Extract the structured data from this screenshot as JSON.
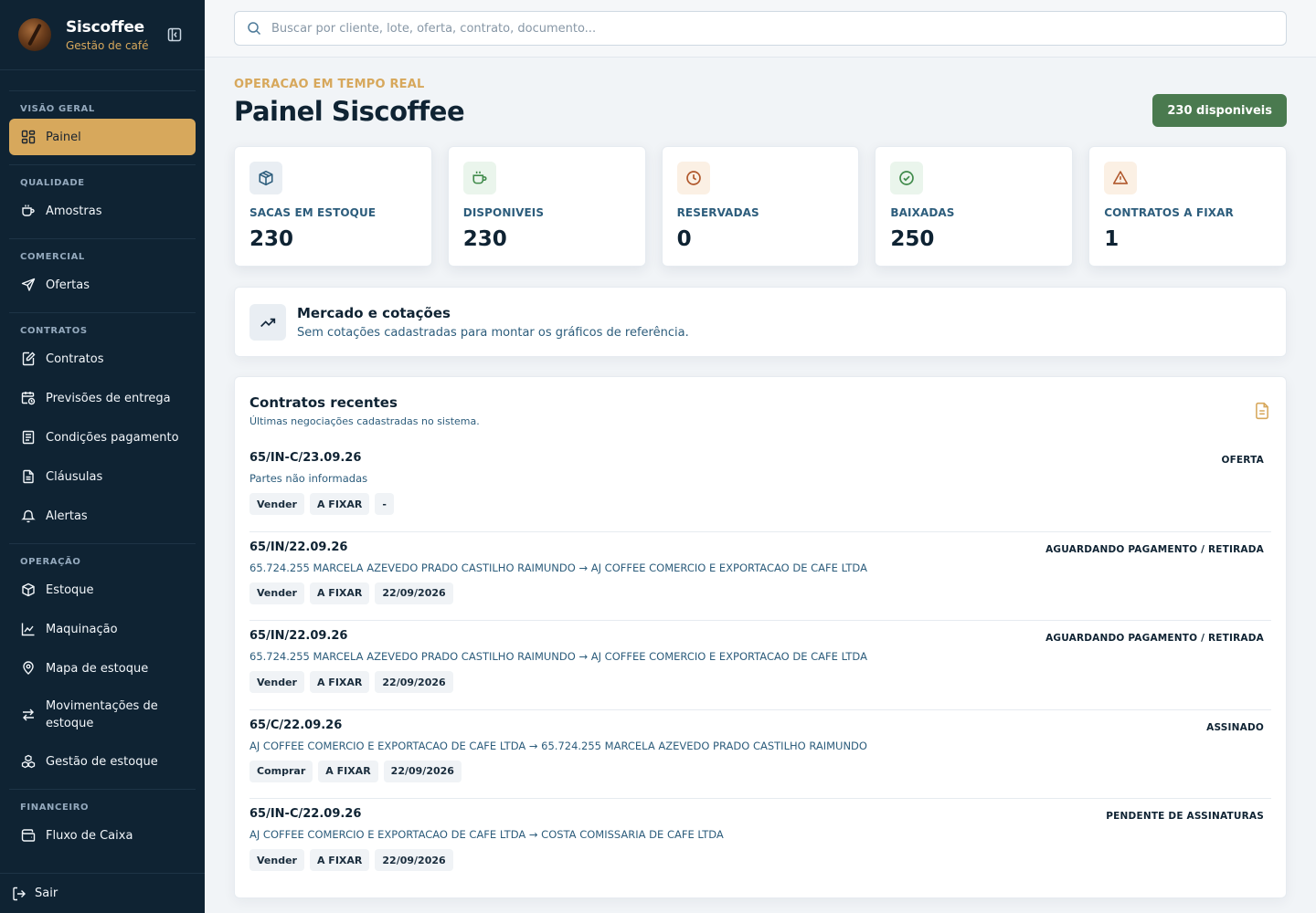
{
  "brand": {
    "name": "Siscoffee",
    "subtitle": "Gestão de café"
  },
  "sidebar": {
    "sections": [
      {
        "title": "VISÃO GERAL",
        "items": [
          {
            "label": "Painel",
            "icon": "dashboard-icon",
            "active": true
          }
        ]
      },
      {
        "title": "QUALIDADE",
        "items": [
          {
            "label": "Amostras",
            "icon": "cup-icon"
          }
        ]
      },
      {
        "title": "COMERCIAL",
        "items": [
          {
            "label": "Ofertas",
            "icon": "send-icon"
          }
        ]
      },
      {
        "title": "CONTRATOS",
        "items": [
          {
            "label": "Contratos",
            "icon": "contract-edit-icon"
          },
          {
            "label": "Previsões de entrega",
            "icon": "calendar-clock-icon"
          },
          {
            "label": "Condições pagamento",
            "icon": "receipt-icon"
          },
          {
            "label": "Cláusulas",
            "icon": "document-icon"
          },
          {
            "label": "Alertas",
            "icon": "bell-icon"
          }
        ]
      },
      {
        "title": "OPERAÇÃO",
        "items": [
          {
            "label": "Estoque",
            "icon": "box-icon"
          },
          {
            "label": "Maquinação",
            "icon": "chart-line-icon"
          },
          {
            "label": "Mapa de estoque",
            "icon": "map-pin-icon"
          },
          {
            "label": "Movimentações de estoque",
            "icon": "swap-icon"
          },
          {
            "label": "Gestão de estoque",
            "icon": "boxes-icon"
          }
        ]
      },
      {
        "title": "FINANCEIRO",
        "items": [
          {
            "label": "Fluxo de Caixa",
            "icon": "wallet-icon"
          }
        ]
      }
    ],
    "logout_label": "Sair"
  },
  "search": {
    "placeholder": "Buscar por cliente, lote, oferta, contrato, documento..."
  },
  "header": {
    "eyebrow": "OPERACAO EM TEMPO REAL",
    "title": "Painel Siscoffee",
    "badge": "230 disponiveis"
  },
  "stats": [
    {
      "label": "SACAS EM ESTOQUE",
      "value": "230",
      "icon": "package-icon",
      "accent": "#2d5d7c",
      "bg": "#e9eef3"
    },
    {
      "label": "DISPONIVEIS",
      "value": "230",
      "icon": "coffee-cup-icon",
      "accent": "#3f8a4a",
      "bg": "#eaf5ec"
    },
    {
      "label": "RESERVADAS",
      "value": "0",
      "icon": "clock-icon",
      "accent": "#b0572b",
      "bg": "#fbf0e4"
    },
    {
      "label": "BAIXADAS",
      "value": "250",
      "icon": "check-circle-icon",
      "accent": "#3f8a4a",
      "bg": "#eaf5ec"
    },
    {
      "label": "CONTRATOS A FIXAR",
      "value": "1",
      "icon": "warning-icon",
      "accent": "#b0572b",
      "bg": "#fbf0e4"
    }
  ],
  "market": {
    "title": "Mercado e cotações",
    "subtitle": "Sem cotações cadastradas para montar os gráficos de referência."
  },
  "recent": {
    "title": "Contratos recentes",
    "subtitle": "Últimas negociações cadastradas no sistema.",
    "rows": [
      {
        "code": "65/IN-C/23.09.26",
        "status": "OFERTA",
        "parties": "Partes não informadas",
        "tags": [
          "Vender",
          "A FIXAR",
          "-"
        ]
      },
      {
        "code": "65/IN/22.09.26",
        "status": "AGUARDANDO PAGAMENTO / RETIRADA",
        "parties": "65.724.255 MARCELA AZEVEDO PRADO CASTILHO RAIMUNDO → AJ COFFEE COMERCIO E EXPORTACAO DE CAFE LTDA",
        "tags": [
          "Vender",
          "A FIXAR",
          "22/09/2026"
        ]
      },
      {
        "code": "65/IN/22.09.26",
        "status": "AGUARDANDO PAGAMENTO / RETIRADA",
        "parties": "65.724.255 MARCELA AZEVEDO PRADO CASTILHO RAIMUNDO → AJ COFFEE COMERCIO E EXPORTACAO DE CAFE LTDA",
        "tags": [
          "Vender",
          "A FIXAR",
          "22/09/2026"
        ]
      },
      {
        "code": "65/C/22.09.26",
        "status": "ASSINADO",
        "parties": "AJ COFFEE COMERCIO E EXPORTACAO DE CAFE LTDA → 65.724.255 MARCELA AZEVEDO PRADO CASTILHO RAIMUNDO",
        "tags": [
          "Comprar",
          "A FIXAR",
          "22/09/2026"
        ]
      },
      {
        "code": "65/IN-C/22.09.26",
        "status": "PENDENTE DE ASSINATURAS",
        "parties": "AJ COFFEE COMERCIO E EXPORTACAO DE CAFE LTDA → COSTA COMISSARIA DE CAFE LTDA",
        "tags": [
          "Vender",
          "A FIXAR",
          "22/09/2026"
        ]
      }
    ]
  }
}
